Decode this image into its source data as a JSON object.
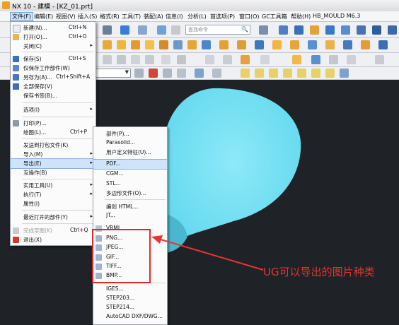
{
  "titlebar": {
    "title": "NX 10 - 建模 - [KZ_01.prt]"
  },
  "menubar": {
    "items": [
      "文件(F)",
      "编辑(E)",
      "视图(V)",
      "插入(S)",
      "格式(R)",
      "工具(T)",
      "装配(A)",
      "信息(I)",
      "分析(L)",
      "首选项(P)",
      "窗口(O)",
      "GC工具箱",
      "帮助(H)",
      "HB_MOULD M6.3"
    ]
  },
  "toolbar": {
    "search_placeholder": "查找命令"
  },
  "file_menu": {
    "items": [
      {
        "label": "新建(N)...",
        "shortcut": "Ctrl+N"
      },
      {
        "label": "打开(O)...",
        "shortcut": "Ctrl+O"
      },
      {
        "label": "关闭(C)",
        "shortcut": ""
      },
      {
        "label": "保存(S)",
        "shortcut": "Ctrl+S"
      },
      {
        "label": "仅保存工作部件(W)",
        "shortcut": ""
      },
      {
        "label": "另存为(A)...",
        "shortcut": "Ctrl+Shift+A"
      },
      {
        "label": "全部保存(V)",
        "shortcut": ""
      },
      {
        "label": "保存书签(B)...",
        "shortcut": ""
      },
      {
        "label": "选项(I)",
        "shortcut": ""
      },
      {
        "label": "打印(P)...",
        "shortcut": ""
      },
      {
        "label": "绘图(L)...",
        "shortcut": "Ctrl+P"
      },
      {
        "label": "发送到打包文件(K)",
        "shortcut": ""
      },
      {
        "label": "导入(M)",
        "shortcut": ""
      },
      {
        "label": "导出(E)",
        "shortcut": ""
      },
      {
        "label": "互操作(B)",
        "shortcut": ""
      },
      {
        "label": "实用工具(U)",
        "shortcut": ""
      },
      {
        "label": "执行(T)",
        "shortcut": ""
      },
      {
        "label": "属性(I)",
        "shortcut": ""
      },
      {
        "label": "最近打开的部件(Y)",
        "shortcut": ""
      },
      {
        "label": "完成草图(K)",
        "shortcut": "Ctrl+Q"
      },
      {
        "label": "退出(X)",
        "shortcut": ""
      }
    ]
  },
  "export_menu": {
    "items": [
      {
        "label": "部件(P)..."
      },
      {
        "label": "Parasolid..."
      },
      {
        "label": "用户定义特征(U)..."
      },
      {
        "label": "PDF..."
      },
      {
        "label": "CGM..."
      },
      {
        "label": "STL..."
      },
      {
        "label": "多边形文件(O)..."
      },
      {
        "label": "编创 HTML..."
      },
      {
        "label": "JT..."
      },
      {
        "label": "VRML..."
      },
      {
        "label": "PNG..."
      },
      {
        "label": "JPEG..."
      },
      {
        "label": "GIF..."
      },
      {
        "label": "TIFF..."
      },
      {
        "label": "BMP..."
      },
      {
        "label": "IGES..."
      },
      {
        "label": "STEP203..."
      },
      {
        "label": "STEP214..."
      },
      {
        "label": "AutoCAD DXF/DWG..."
      }
    ]
  },
  "annotation": {
    "text": "UG可以导出的图片种类",
    "color": "#e83333"
  },
  "colors": {
    "model": "#79e4f5",
    "viewport_bg": "#1f2226",
    "highlight": "#cfe3fb"
  }
}
